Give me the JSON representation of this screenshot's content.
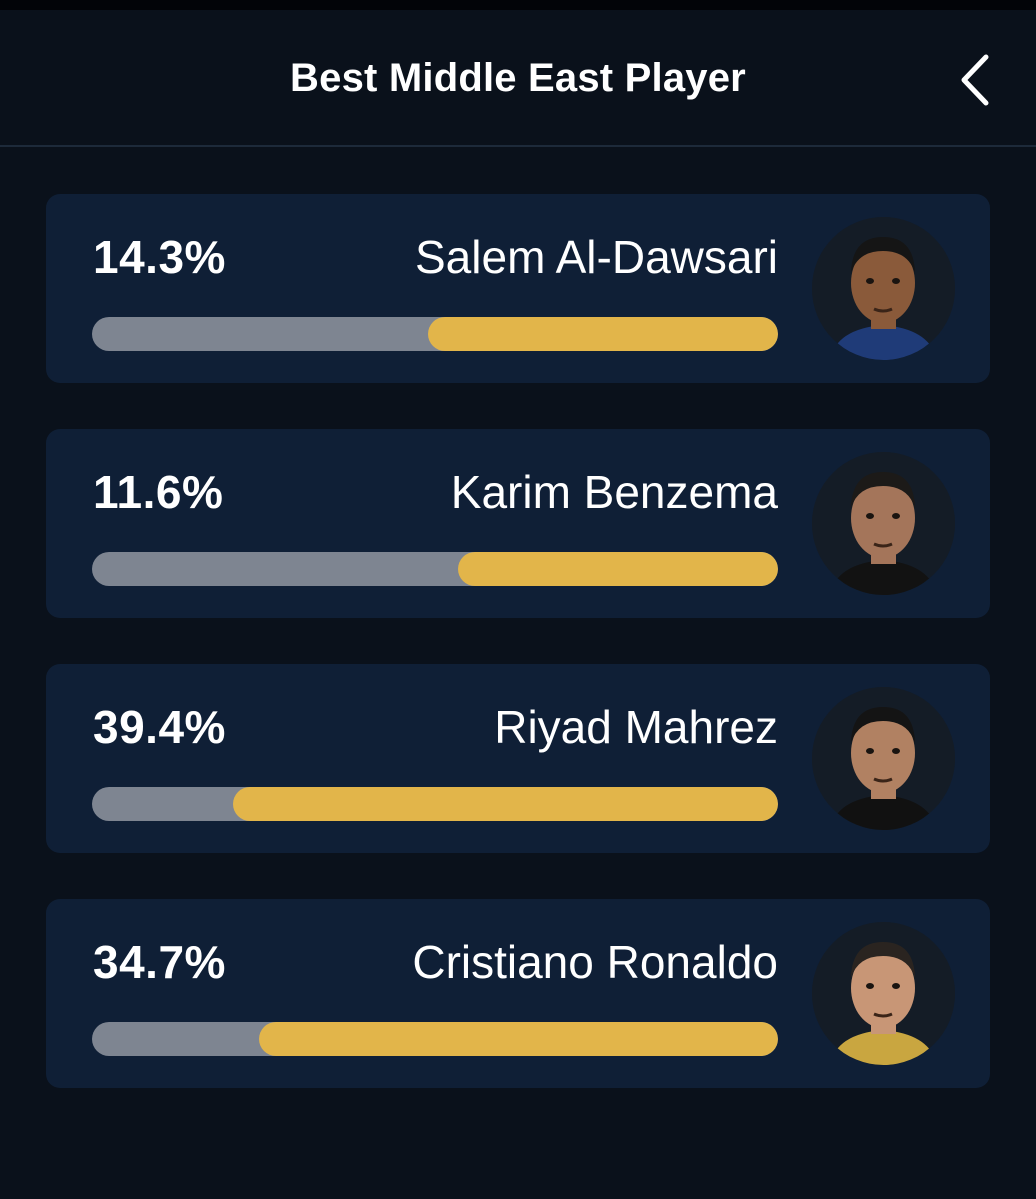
{
  "header": {
    "title": "Best Middle East Player",
    "back_icon": "chevron-left-icon"
  },
  "players": [
    {
      "name": "Salem Al-Dawsari",
      "percent_label": "14.3%",
      "bar_fill_fraction": 0.51,
      "avatar": "player-photo-icon",
      "skin": "#8a5a3a",
      "hair": "#151515",
      "shirt": "#1f3b78"
    },
    {
      "name": "Karim Benzema",
      "percent_label": "11.6%",
      "bar_fill_fraction": 0.467,
      "avatar": "player-photo-icon",
      "skin": "#a4755a",
      "hair": "#1c1a18",
      "shirt": "#121212"
    },
    {
      "name": "Riyad Mahrez",
      "percent_label": "39.4%",
      "bar_fill_fraction": 0.794,
      "avatar": "player-photo-icon",
      "skin": "#b18162",
      "hair": "#141414",
      "shirt": "#111111"
    },
    {
      "name": "Cristiano Ronaldo",
      "percent_label": "34.7%",
      "bar_fill_fraction": 0.757,
      "avatar": "player-photo-icon",
      "skin": "#c89676",
      "hair": "#2a2420",
      "shirt": "#c9a640"
    }
  ],
  "colors": {
    "background": "#0a111b",
    "card": "#0f1f36",
    "bar_track": "#7e8591",
    "bar_fill": "#e2b54a"
  }
}
